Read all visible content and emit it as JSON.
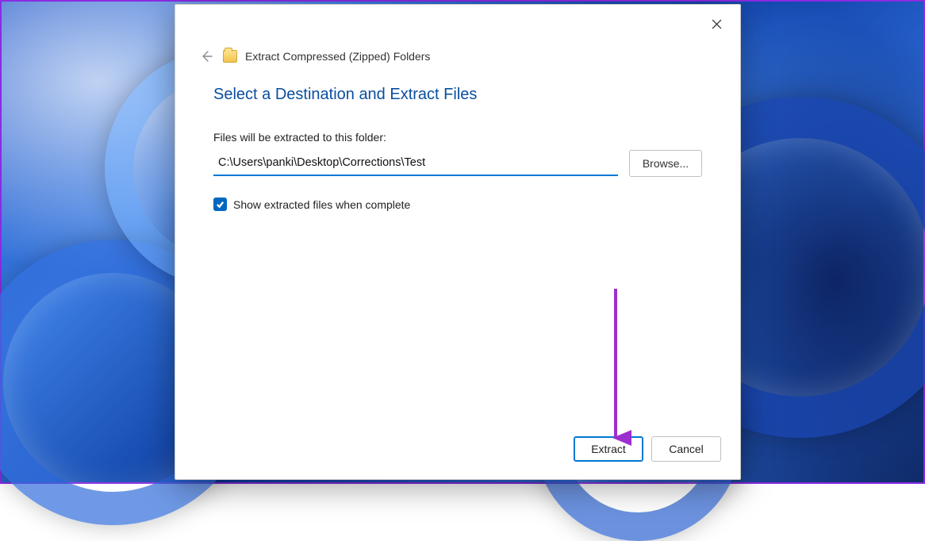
{
  "dialog": {
    "title": "Extract Compressed (Zipped) Folders",
    "heading": "Select a Destination and Extract Files",
    "field_label": "Files will be extracted to this folder:",
    "path_value": "C:\\Users\\panki\\Desktop\\Corrections\\Test",
    "browse_label": "Browse...",
    "checkbox_label": "Show extracted files when complete",
    "checkbox_checked": true,
    "extract_label": "Extract",
    "cancel_label": "Cancel"
  }
}
